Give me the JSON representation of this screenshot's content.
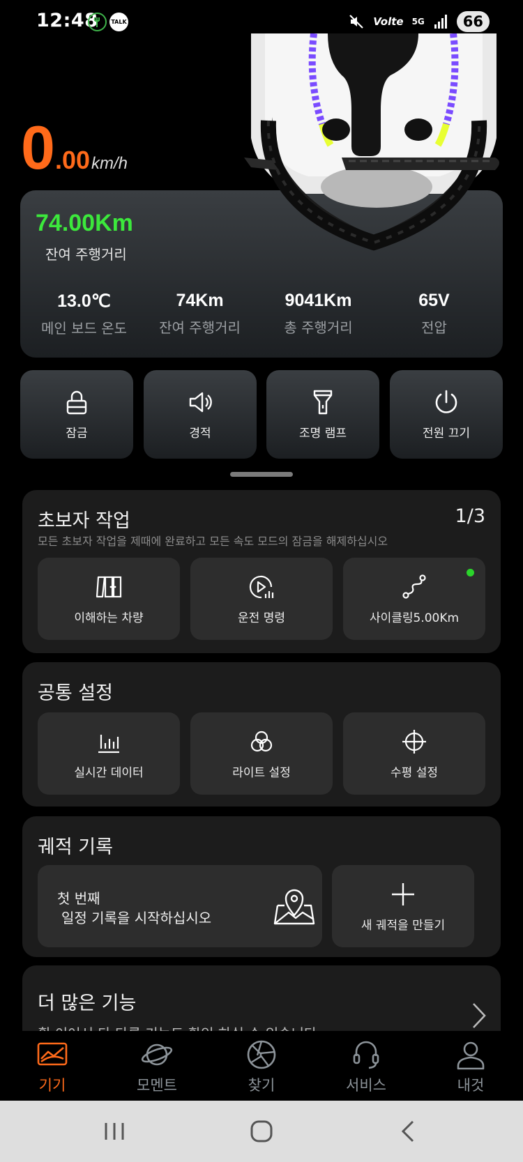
{
  "status_bar": {
    "time": "12:48",
    "app_icons": [
      "fork-app-icon",
      "kakao-talk-icon"
    ],
    "talk_text": "TALK",
    "volte": "Volte",
    "network": "5G",
    "battery": "66"
  },
  "dashboard": {
    "speed_int": "0",
    "speed_dec": ".00",
    "speed_unit": "km/h",
    "range_big": "74.00Km",
    "range_label": "잔여 주행거리",
    "stats": [
      {
        "value": "13.0℃",
        "label": "메인 보드 온도"
      },
      {
        "value": "74Km",
        "label": "잔여 주행거리"
      },
      {
        "value": "9041Km",
        "label": "총 주행거리"
      },
      {
        "value": "65V",
        "label": "전압"
      }
    ]
  },
  "controls": [
    {
      "label": "잠금",
      "icon": "lock-icon"
    },
    {
      "label": "경적",
      "icon": "speaker-icon"
    },
    {
      "label": "조명 램프",
      "icon": "flashlight-icon"
    },
    {
      "label": "전원 끄기",
      "icon": "power-icon"
    }
  ],
  "beginner": {
    "title": "초보자 작업",
    "count": "1/3",
    "subtitle": "모든 초보자 작업을 제때에 완료하고 모든 속도 모드의 잠금을 해제하십시오",
    "tiles": [
      {
        "label": "이해하는 차량",
        "icon": "vehicle-panels-icon"
      },
      {
        "label": "운전 명령",
        "icon": "play-stats-icon"
      },
      {
        "label": "사이클링5.00Km",
        "icon": "route-icon"
      }
    ]
  },
  "common": {
    "title": "공통 설정",
    "tiles": [
      {
        "label": "실시간 데이터",
        "icon": "bar-chart-icon"
      },
      {
        "label": "라이트 설정",
        "icon": "color-circles-icon"
      },
      {
        "label": "수평 설정",
        "icon": "crosshair-icon"
      }
    ]
  },
  "track": {
    "title": "궤적 기록",
    "first_line1": "첫 번째",
    "first_line2": "일정 기록을 시작하십시오",
    "new_label": "새 궤적을 만들기"
  },
  "more": {
    "title": "더 많은 기능",
    "subtitle": "휠 이어서 다 다른 기능도 확인 하실 수 있습니다"
  },
  "bottom_nav": [
    {
      "label": "기기",
      "icon": "device-icon",
      "active": true
    },
    {
      "label": "모멘트",
      "icon": "planet-icon",
      "active": false
    },
    {
      "label": "찾기",
      "icon": "aperture-icon",
      "active": false
    },
    {
      "label": "서비스",
      "icon": "headset-icon",
      "active": false
    },
    {
      "label": "내것",
      "icon": "profile-icon",
      "active": false
    }
  ],
  "colors": {
    "accent": "#ff6a1a",
    "range_green": "#3ce83c",
    "indicator_green": "#2bd42b"
  }
}
